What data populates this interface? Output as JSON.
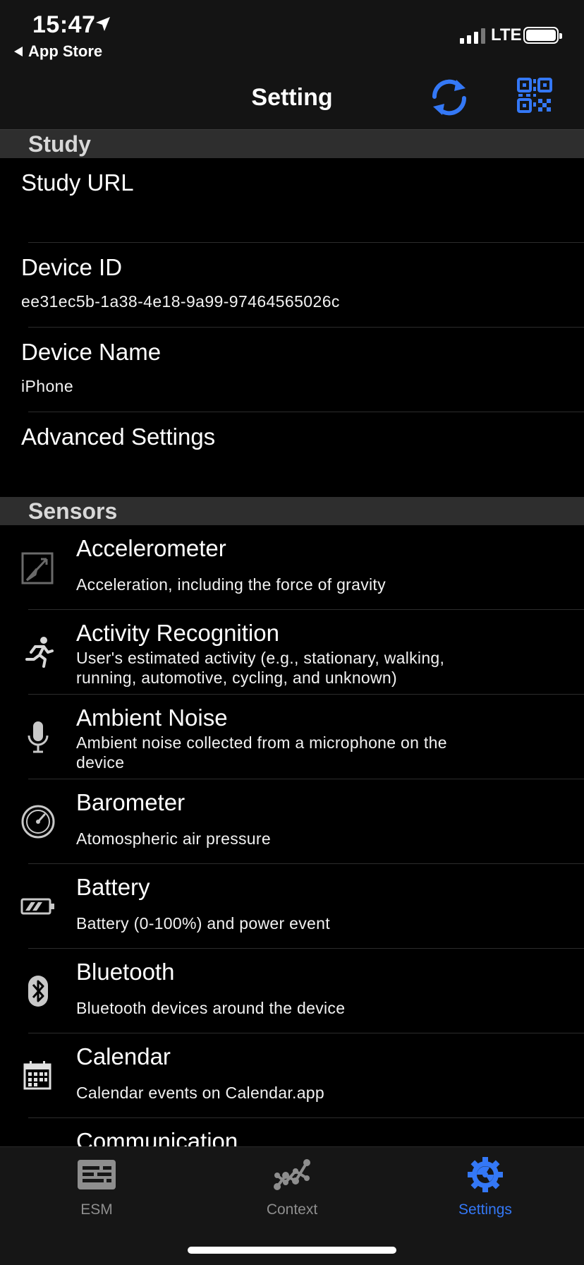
{
  "status_bar": {
    "time": "15:47",
    "back_app": "App Store",
    "network": "LTE"
  },
  "nav": {
    "title": "Setting",
    "sync_icon": "sync-icon",
    "qr_icon": "qr-code-icon"
  },
  "sections": {
    "study": {
      "header": "Study",
      "rows": [
        {
          "title": "Study URL",
          "value": ""
        },
        {
          "title": "Device ID",
          "value": "ee31ec5b-1a38-4e18-9a99-97464565026c"
        },
        {
          "title": "Device Name",
          "value": "iPhone"
        },
        {
          "title": "Advanced Settings",
          "value": ""
        }
      ]
    },
    "sensors": {
      "header": "Sensors",
      "items": [
        {
          "title": "Accelerometer",
          "desc": "Acceleration, including the force of gravity",
          "icon": "accelerometer-icon"
        },
        {
          "title": "Activity Recognition",
          "desc": "User's estimated activity (e.g., stationary, walking, running, automotive, cycling, and unknown)",
          "icon": "running-person-icon"
        },
        {
          "title": "Ambient Noise",
          "desc": "Ambient noise collected from a microphone on the device",
          "icon": "microphone-icon"
        },
        {
          "title": "Barometer",
          "desc": "Atomospheric air pressure",
          "icon": "gauge-icon"
        },
        {
          "title": "Battery",
          "desc": "Battery (0-100%) and power event",
          "icon": "battery-icon"
        },
        {
          "title": "Bluetooth",
          "desc": "Bluetooth devices around the device",
          "icon": "bluetooth-icon"
        },
        {
          "title": "Calendar",
          "desc": "Calendar events on Calendar.app",
          "icon": "calendar-icon"
        },
        {
          "title": "Communication",
          "desc": "",
          "icon": ""
        }
      ]
    }
  },
  "tabs": [
    {
      "label": "ESM",
      "icon": "esm-list-icon",
      "active": false
    },
    {
      "label": "Context",
      "icon": "context-graph-icon",
      "active": false
    },
    {
      "label": "Settings",
      "icon": "settings-gear-icon",
      "active": true
    }
  ],
  "colors": {
    "accent": "#3478f6",
    "background": "#000000",
    "section_header": "#2e2e2e",
    "inactive_tab": "#8e8e8e"
  }
}
